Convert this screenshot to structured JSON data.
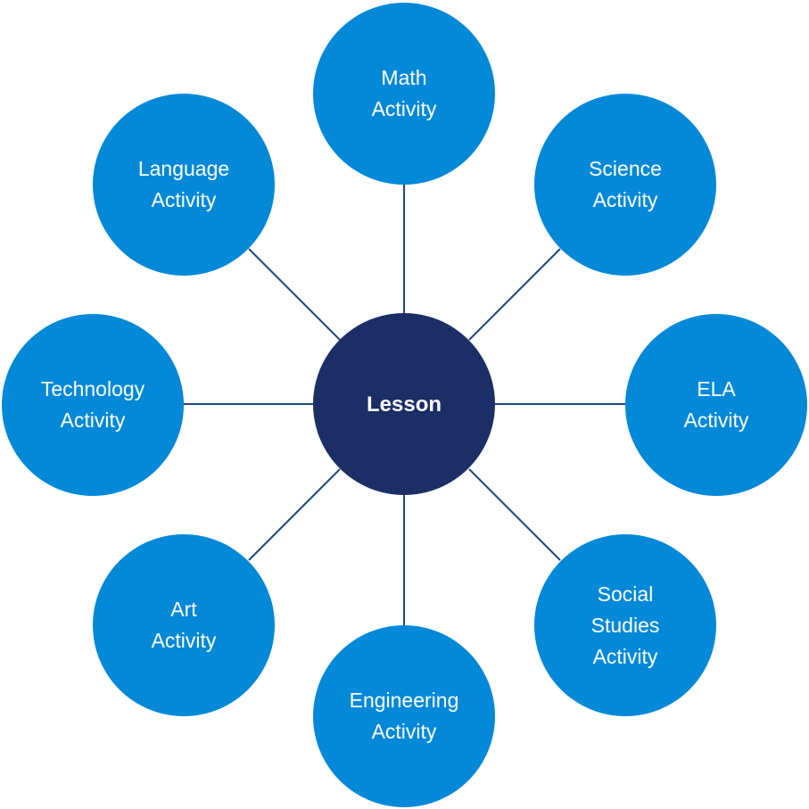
{
  "colors": {
    "activity_fill": "#0489d9",
    "center_fill": "#1b2f66",
    "connector": "#1f4a7a",
    "text": "#ffffff"
  },
  "center": {
    "label": "Lesson"
  },
  "activities": [
    {
      "id": "math",
      "label": "Math\nActivity"
    },
    {
      "id": "science",
      "label": "Science\nActivity"
    },
    {
      "id": "ela",
      "label": "ELA\nActivity"
    },
    {
      "id": "social-studies",
      "label": "Social\nStudies\nActivity"
    },
    {
      "id": "engineering",
      "label": "Engineering\nActivity"
    },
    {
      "id": "art",
      "label": "Art\nActivity"
    },
    {
      "id": "technology",
      "label": "Technology\nActivity"
    },
    {
      "id": "language",
      "label": "Language\nActivity"
    }
  ]
}
